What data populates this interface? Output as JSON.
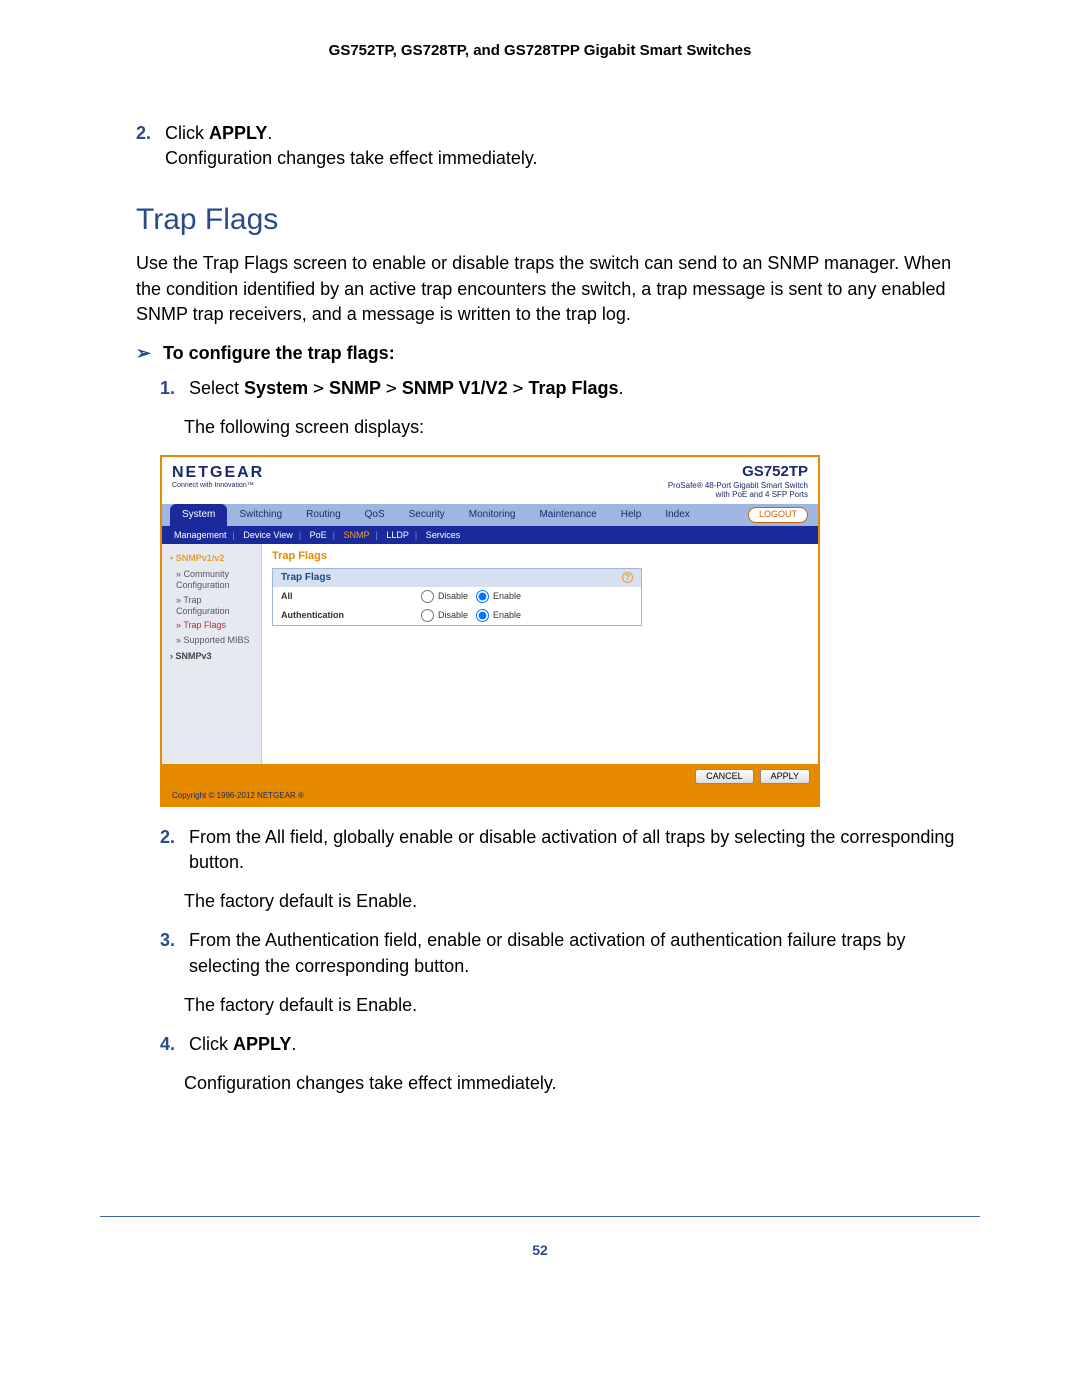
{
  "doc_header": "GS752TP, GS728TP, and GS728TPP Gigabit Smart Switches",
  "step2": {
    "num": "2.",
    "prefix": "Click ",
    "cmd": "APPLY",
    "suffix": ".",
    "follow": "Configuration changes take effect immediately."
  },
  "section_title": "Trap Flags",
  "intro": "Use the Trap Flags screen to enable or disable traps the switch can send to an SNMP manager. When the condition identified by an active trap encounters the switch, a trap message is sent to any enabled SNMP trap receivers, and a message is written to the trap log.",
  "task_head": "To configure the trap flags:",
  "arrow": "➢",
  "step1b": {
    "num": "1.",
    "prefix": "Select ",
    "path": [
      "System",
      "SNMP",
      "SNMP V1/V2",
      "Trap Flags"
    ],
    "sep": ">",
    "suffix": ".",
    "follow": "The following screen displays:"
  },
  "ui": {
    "brand": "NETGEAR",
    "brand_tag": "Connect with Innovation™",
    "model": "GS752TP",
    "desc1": "ProSafe® 48-Port Gigabit Smart Switch",
    "desc2": "with PoE and 4 SFP Ports",
    "tabs": [
      "System",
      "Switching",
      "Routing",
      "QoS",
      "Security",
      "Monitoring",
      "Maintenance",
      "Help",
      "Index"
    ],
    "logout": "LOGOUT",
    "subtabs": [
      "Management",
      "Device View",
      "PoE",
      "SNMP",
      "LLDP",
      "Services"
    ],
    "sidebar_head1_marker": "▪",
    "sidebar_head1": "SNMPv1/v2",
    "sb_items": [
      "» Community Configuration",
      "» Trap Configuration",
      "» Trap Flags",
      "» Supported MIBS"
    ],
    "sidebar_head2_marker": "›",
    "sidebar_head2": "SNMPv3",
    "panel_title": "Trap Flags",
    "panel_head": "Trap Flags",
    "help_q": "?",
    "rows": [
      {
        "label": "All",
        "opt_disable": "Disable",
        "opt_enable": "Enable"
      },
      {
        "label": "Authentication",
        "opt_disable": "Disable",
        "opt_enable": "Enable"
      }
    ],
    "btn_cancel": "CANCEL",
    "btn_apply": "APPLY",
    "copyright": "Copyright © 1996-2012 NETGEAR ®"
  },
  "step2b": {
    "num": "2.",
    "text": "From the All field, globally enable or disable activation of all traps by selecting the corresponding button.",
    "follow": "The factory default is Enable."
  },
  "step3b": {
    "num": "3.",
    "text": "From the Authentication field, enable or disable activation of authentication failure traps by selecting the corresponding button.",
    "follow": "The factory default is Enable."
  },
  "step4b": {
    "num": "4.",
    "prefix": "Click ",
    "cmd": "APPLY",
    "suffix": ".",
    "follow": "Configuration changes take effect immediately."
  },
  "page_num": "52"
}
